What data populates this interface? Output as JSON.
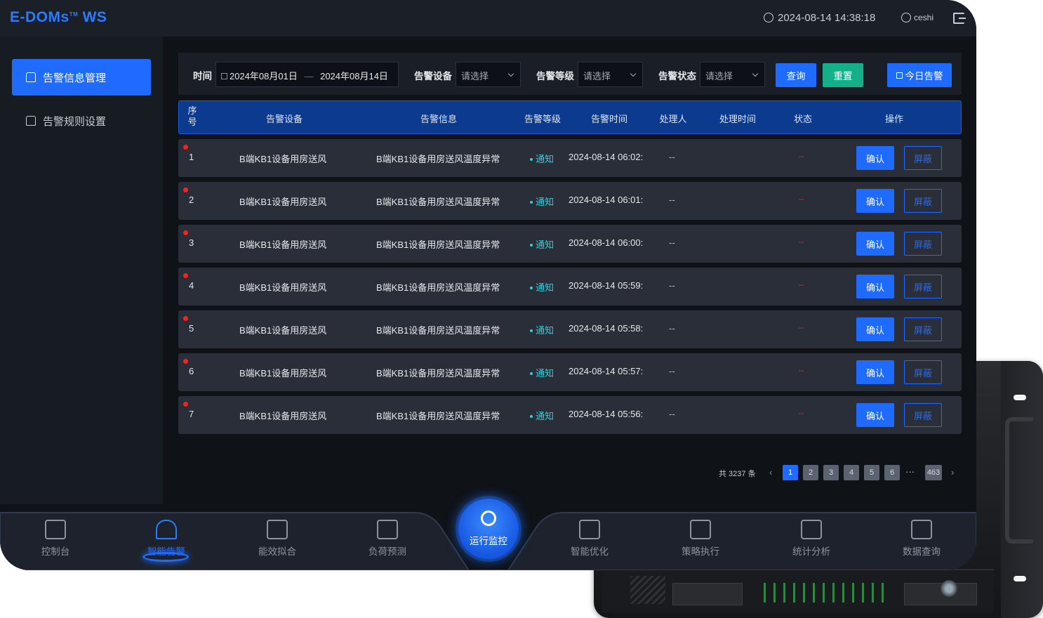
{
  "brand": {
    "logo": "E-DOMs",
    "tm": "TM",
    "suffix": "WS"
  },
  "header": {
    "datetime": "2024-08-14 14:38:18",
    "username": "ceshi"
  },
  "sidebar": {
    "items": [
      {
        "label": "告警信息管理",
        "active": true
      },
      {
        "label": "告警规则设置",
        "active": false
      }
    ]
  },
  "filters": {
    "time_label": "时间",
    "date_start": "2024年08月01日",
    "date_sep": "—",
    "date_end": "2024年08月14日",
    "device_label": "告警设备",
    "device_placeholder": "请选择",
    "level_label": "告警等级",
    "level_placeholder": "请选择",
    "status_label": "告警状态",
    "status_placeholder": "请选择",
    "query_button": "查询",
    "reset_button": "重置",
    "today_button": "今日告警"
  },
  "table": {
    "headers": {
      "seq": "序号",
      "device": "告警设备",
      "info": "告警信息",
      "level": "告警等级",
      "time": "告警时间",
      "handler": "处理人",
      "handle_time": "处理时间",
      "status": "状态",
      "action": "操作"
    },
    "rows": [
      {
        "seq": "1",
        "device": "B端KB1设备用房送风",
        "info": "B端KB1设备用房送风温度异常",
        "level": "通知",
        "time": "2024-08-14 06:02:",
        "handler": "--",
        "status": "--",
        "confirm": "确认",
        "shield": "屏蔽"
      },
      {
        "seq": "2",
        "device": "B端KB1设备用房送风",
        "info": "B端KB1设备用房送风温度异常",
        "level": "通知",
        "time": "2024-08-14 06:01:",
        "handler": "--",
        "status": "--",
        "confirm": "确认",
        "shield": "屏蔽"
      },
      {
        "seq": "3",
        "device": "B端KB1设备用房送风",
        "info": "B端KB1设备用房送风温度异常",
        "level": "通知",
        "time": "2024-08-14 06:00:",
        "handler": "--",
        "status": "--",
        "confirm": "确认",
        "shield": "屏蔽"
      },
      {
        "seq": "4",
        "device": "B端KB1设备用房送风",
        "info": "B端KB1设备用房送风温度异常",
        "level": "通知",
        "time": "2024-08-14 05:59:",
        "handler": "--",
        "status": "--",
        "confirm": "确认",
        "shield": "屏蔽"
      },
      {
        "seq": "5",
        "device": "B端KB1设备用房送风",
        "info": "B端KB1设备用房送风温度异常",
        "level": "通知",
        "time": "2024-08-14 05:58:",
        "handler": "--",
        "status": "--",
        "confirm": "确认",
        "shield": "屏蔽"
      },
      {
        "seq": "6",
        "device": "B端KB1设备用房送风",
        "info": "B端KB1设备用房送风温度异常",
        "level": "通知",
        "time": "2024-08-14 05:57:",
        "handler": "--",
        "status": "--",
        "confirm": "确认",
        "shield": "屏蔽"
      },
      {
        "seq": "7",
        "device": "B端KB1设备用房送风",
        "info": "B端KB1设备用房送风温度异常",
        "level": "通知",
        "time": "2024-08-14 05:56:",
        "handler": "--",
        "status": "--",
        "confirm": "确认",
        "shield": "屏蔽"
      }
    ]
  },
  "pagination": {
    "total": "共 3237 条",
    "prev": "‹",
    "next": "›",
    "pages": [
      "1",
      "2",
      "3",
      "4",
      "5",
      "6"
    ],
    "current": "1",
    "ellipsis": "···",
    "last": "463"
  },
  "dock": {
    "items": [
      {
        "label": "控制台",
        "icon": "monitor-icon"
      },
      {
        "label": "智能告警",
        "icon": "alarm-siren-icon",
        "active": true
      },
      {
        "label": "能效拟合",
        "icon": "cube-icon"
      },
      {
        "label": "负荷预测",
        "icon": "trend-chart-icon"
      },
      {
        "label": "智能优化",
        "icon": "sliders-icon"
      },
      {
        "label": "策略执行",
        "icon": "checklist-icon"
      },
      {
        "label": "统计分析",
        "icon": "bar-chart-icon"
      },
      {
        "label": "数据查询",
        "icon": "search-list-icon"
      }
    ],
    "center": {
      "label": "运行监控",
      "icon": "camera-icon"
    }
  },
  "colors": {
    "accent": "#1f6bff",
    "reset": "#13b08a",
    "level_notice": "#27d3e0",
    "alert_dot": "#ff1f1f",
    "header_row": "#0b3a8f",
    "background": "#0f1217"
  }
}
